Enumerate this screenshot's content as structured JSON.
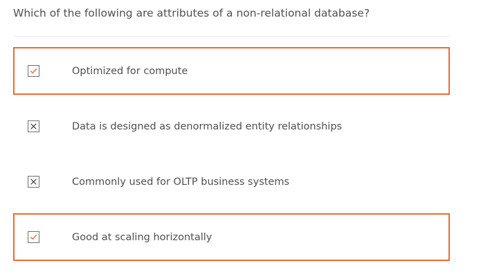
{
  "question": {
    "text": "Which of the following are attributes of a non-relational database?"
  },
  "options": [
    {
      "label": "Optimized for compute",
      "selected": true,
      "mark": "check-icon"
    },
    {
      "label": "Data is designed as denormalized entity relationships",
      "selected": false,
      "mark": "x-icon"
    },
    {
      "label": "Commonly used for OLTP business systems",
      "selected": false,
      "mark": "x-icon"
    },
    {
      "label": "Good at scaling horizontally",
      "selected": true,
      "mark": "check-icon"
    }
  ],
  "colors": {
    "accent": "#ec6c2f",
    "check": "#ec6c2f",
    "x_mark": "#333333",
    "text": "#4f4f4f"
  }
}
